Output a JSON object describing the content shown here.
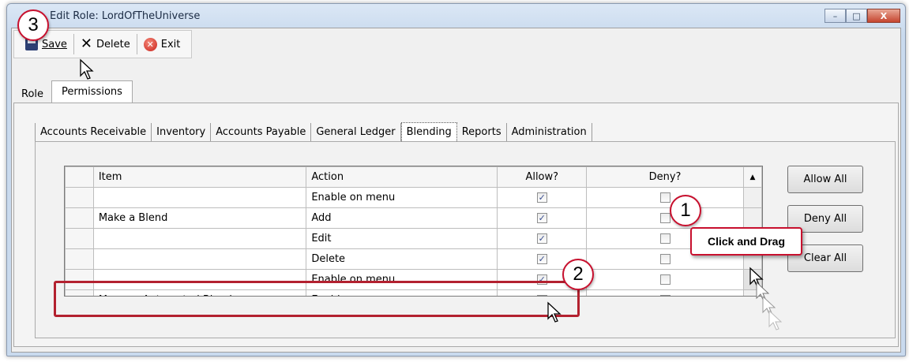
{
  "window": {
    "title": "Edit Role: LordOfTheUniverse",
    "controls": {
      "minimize": "–",
      "maximize": "□",
      "close": "X"
    }
  },
  "toolbar": {
    "save_label": "Save",
    "delete_label": "Delete",
    "exit_label": "Exit"
  },
  "outer_tabs": {
    "role": "Role",
    "permissions": "Permissions",
    "active": "Permissions"
  },
  "inner_tabs": {
    "items": [
      "Accounts Receivable",
      "Inventory",
      "Accounts Payable",
      "General Ledger",
      "Blending",
      "Reports",
      "Administration"
    ],
    "active": "Blending"
  },
  "grid": {
    "headers": {
      "item": "Item",
      "action": "Action",
      "allow": "Allow?",
      "deny": "Deny?"
    },
    "rows": [
      {
        "item": "",
        "action": "Enable on menu",
        "allow": true,
        "deny": false
      },
      {
        "item": "Make a Blend",
        "action": "Add",
        "allow": true,
        "deny": false
      },
      {
        "item": "",
        "action": "Edit",
        "allow": true,
        "deny": false
      },
      {
        "item": "",
        "action": "Delete",
        "allow": true,
        "deny": false
      },
      {
        "item": "",
        "action": "Enable on menu",
        "allow": true,
        "deny": false
      },
      {
        "item": "Manage Automated Blenders",
        "action": "Enable on menu",
        "allow": true,
        "deny": false
      }
    ]
  },
  "side_buttons": {
    "allow_all": "Allow All",
    "deny_all": "Deny All",
    "clear_all": "Clear All"
  },
  "annotations": {
    "callout_1": "1",
    "callout_2": "2",
    "callout_3": "3",
    "tooltip": "Click and Drag",
    "highlight_color": "#b3212f"
  }
}
